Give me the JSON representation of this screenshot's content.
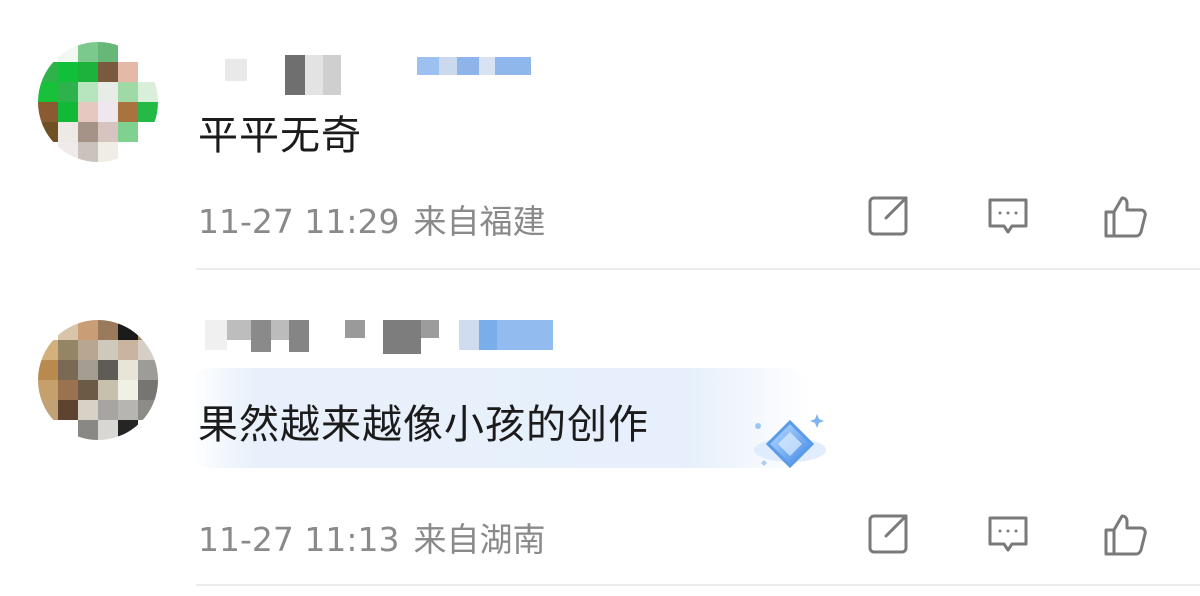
{
  "comments": [
    {
      "text": "平平无奇",
      "date": "11-27",
      "time": "11:29",
      "location": "来自福建"
    },
    {
      "text": "果然越来越像小孩的创作",
      "date": "11-27",
      "time": "11:13",
      "location": "来自湖南"
    }
  ],
  "icons": {
    "share": "share-icon",
    "reply": "comment-icon",
    "like": "thumbs-up-icon",
    "badge": "diamond-icon"
  },
  "colors": {
    "text": "#1b1b1b",
    "meta": "#8a8a8a",
    "divider": "#ececec",
    "icon": "#7a7a7a",
    "badge": "#4a8fe8"
  }
}
